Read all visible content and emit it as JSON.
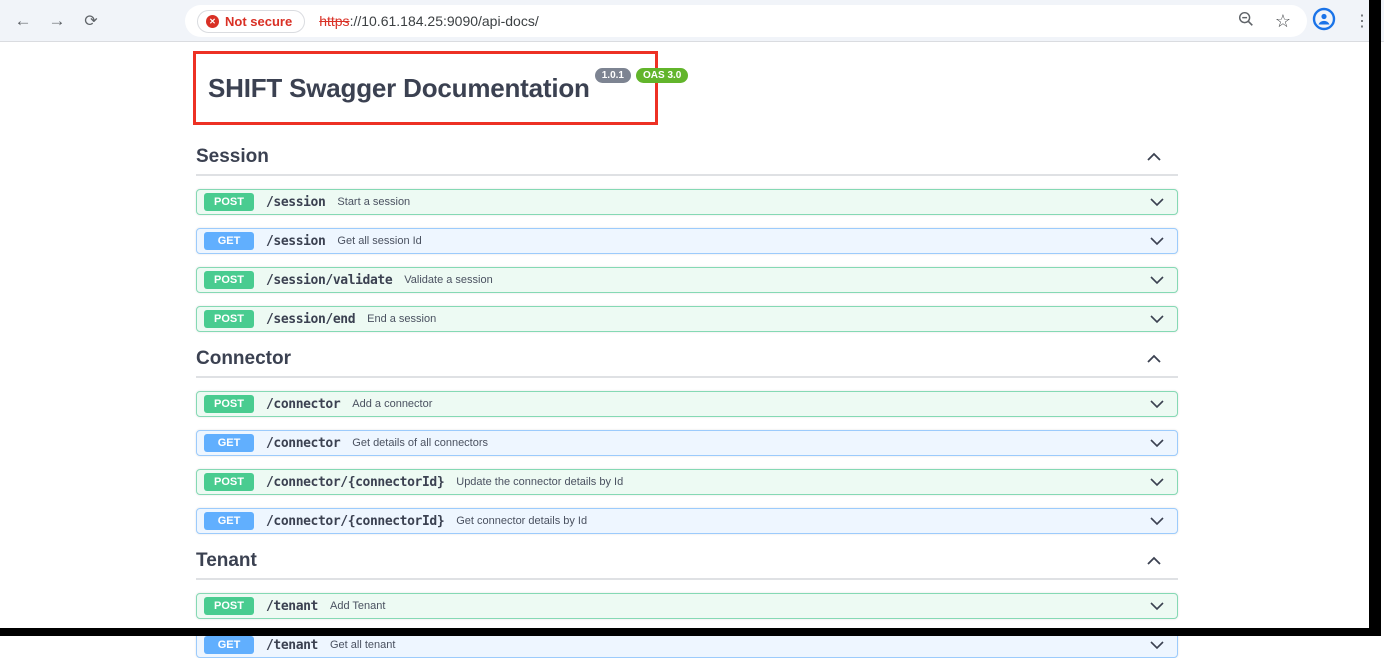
{
  "browser": {
    "back_glyph": "←",
    "forward_glyph": "→",
    "refresh_glyph": "⟳",
    "security_chip_label": "Not secure",
    "security_x_glyph": "✕",
    "url_scheme": "https",
    "url_rest": "://10.61.184.25:9090/api-docs/",
    "star_glyph": "☆",
    "menu_glyph": "⋮"
  },
  "header": {
    "title": "SHIFT Swagger Documentation",
    "version_badge": "1.0.1",
    "oas_badge": "OAS 3.0"
  },
  "sections": [
    {
      "name": "Session",
      "endpoints": [
        {
          "method": "POST",
          "path": "/session",
          "summary": "Start a session"
        },
        {
          "method": "GET",
          "path": "/session",
          "summary": "Get all session Id"
        },
        {
          "method": "POST",
          "path": "/session/validate",
          "summary": "Validate a session"
        },
        {
          "method": "POST",
          "path": "/session/end",
          "summary": "End a session"
        }
      ]
    },
    {
      "name": "Connector",
      "endpoints": [
        {
          "method": "POST",
          "path": "/connector",
          "summary": "Add a connector"
        },
        {
          "method": "GET",
          "path": "/connector",
          "summary": "Get details of all connectors"
        },
        {
          "method": "POST",
          "path": "/connector/{connectorId}",
          "summary": "Update the connector details by Id"
        },
        {
          "method": "GET",
          "path": "/connector/{connectorId}",
          "summary": "Get connector details by Id"
        }
      ]
    },
    {
      "name": "Tenant",
      "endpoints": [
        {
          "method": "POST",
          "path": "/tenant",
          "summary": "Add Tenant"
        },
        {
          "method": "GET",
          "path": "/tenant",
          "summary": "Get all tenant"
        }
      ]
    }
  ],
  "colors": {
    "post_green": "#49cc90",
    "get_blue": "#61affe",
    "annotation_red": "#ed3124",
    "not_secure_red": "#d93025",
    "title_text": "#3b4151"
  }
}
